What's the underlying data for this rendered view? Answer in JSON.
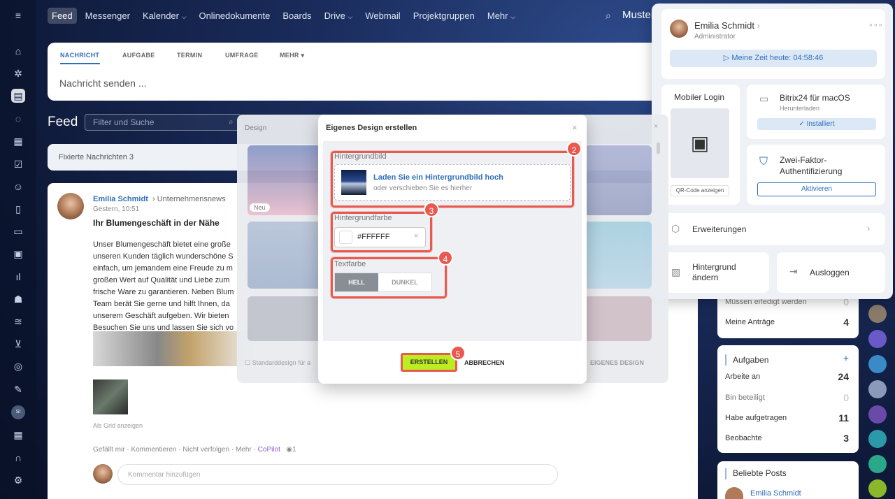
{
  "topnav": {
    "items": [
      "Feed",
      "Messenger",
      "Kalender",
      "Onlinedokumente",
      "Boards",
      "Drive",
      "Webmail",
      "Projektgruppen",
      "Mehr"
    ],
    "brand": "Muster"
  },
  "composer": {
    "tabs": [
      "NACHRICHT",
      "AUFGABE",
      "TERMIN",
      "UMFRAGE",
      "MEHR"
    ],
    "placeholder": "Nachricht senden ..."
  },
  "feed": {
    "title": "Feed",
    "filter_placeholder": "Filter und Suche",
    "pinned": "Fixierte Nachrichten",
    "pinned_count": "3"
  },
  "post": {
    "author": "Emilia Schmidt",
    "channel": "Unternehmensnews",
    "date": "Gestern, 10:51",
    "title": "Ihr Blumengeschäft in der Nähe",
    "body": [
      "Unser Blumengeschäft bietet eine große",
      "unseren Kunden täglich wunderschöne S",
      "einfach, um jemandem eine Freude zu m",
      "großen Wert auf Qualität und Liebe zum",
      "frische Ware zu garantieren. Neben Blum",
      "Team berät Sie gerne und hilft Ihnen, da",
      "unserem Geschäft aufgeben. Wir bieten",
      "Besuchen Sie uns und lassen Sie sich vo"
    ],
    "grid_link": "Als Grid anzeigen",
    "actions": [
      "Gefällt mir",
      "Kommentieren",
      "Nicht verfolgen",
      "Mehr"
    ],
    "copilot": "CoPilot",
    "views": "1",
    "comment_placeholder": "Kommentar hinzufügen"
  },
  "widgets": {
    "tasks_top": [
      {
        "label": "Müssen erledigt werden",
        "value": "0"
      },
      {
        "label": "Meine Anträge",
        "value": "4"
      }
    ],
    "aufgaben_title": "Aufgaben",
    "aufgaben_rows": [
      {
        "label": "Arbeite an",
        "value": "24"
      },
      {
        "label": "Bin beteiligt",
        "value": "0"
      },
      {
        "label": "Habe aufgetragen",
        "value": "11"
      },
      {
        "label": "Beobachte",
        "value": "3"
      }
    ],
    "popular_title": "Beliebte Posts",
    "popular_author": "Emilia Schmidt"
  },
  "profile": {
    "name": "Emilia Schmidt",
    "role": "Administrator",
    "time_label": "Meine Zeit heute: 04:58:46",
    "mobile_login": "Mobiler Login",
    "qr_label": "QR-Code anzeigen",
    "app_title": "Bitrix24 für macOS",
    "app_sub": "Herunterladen",
    "app_status": "Installiert",
    "twofa_title": "Zwei-Faktor-Authentifizierung",
    "twofa_btn": "Aktivieren",
    "extensions": "Erweiterungen",
    "background": "Hintergrund ändern",
    "logout": "Ausloggen"
  },
  "design_overlay": {
    "title": "Design",
    "new_badge": "Neu",
    "checkbox": "Standarddesign für a",
    "own_design": "EIGENES DESIGN"
  },
  "modal": {
    "title": "Eigenes Design erstellen",
    "bg_image_label": "Hintergrundbild",
    "upload_main": "Laden Sie ein Hintergrundbild hoch",
    "upload_sub": "oder verschieben Sie es hierher",
    "bg_color_label": "Hintergrundfarbe",
    "bg_color_value": "#FFFFFF",
    "text_color_label": "Textfarbe",
    "light": "HELL",
    "dark": "DUNKEL",
    "create": "ERSTELLEN",
    "cancel": "ABBRECHEN"
  },
  "badges": [
    "2",
    "3",
    "4",
    "5"
  ],
  "colors": {
    "accent": "#2f6fb8",
    "highlight": "#e85a4f",
    "create_btn": "#bbed21"
  }
}
